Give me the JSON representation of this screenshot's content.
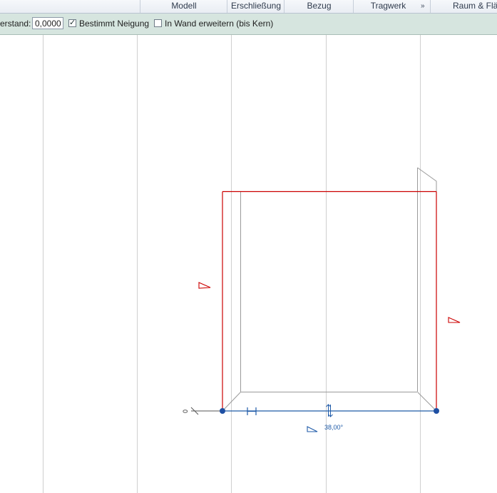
{
  "ribbon_tabs": [
    {
      "label": "Modell"
    },
    {
      "label": "Erschließung"
    },
    {
      "label": "Bezug"
    },
    {
      "label": "Tragwerk"
    },
    {
      "label": "Raum & Flä"
    }
  ],
  "ribbon_more_glyph": "»",
  "options_bar": {
    "overhang_label": "erstand:",
    "overhang_value": "0,0000",
    "defines_slope_label": "Bestimmt Neigung",
    "defines_slope_checked": true,
    "extend_into_wall_label": "In Wand erweitern (bis Kern)",
    "extend_into_wall_checked": false
  },
  "canvas": {
    "slope_angle": "38,00°",
    "zero_marker": "0",
    "colors": {
      "sketch_line": "#cc0000",
      "selected_line": "#1e5aa8",
      "grid_line": "#cfcfcf",
      "model_line": "#9a9a9a"
    }
  }
}
